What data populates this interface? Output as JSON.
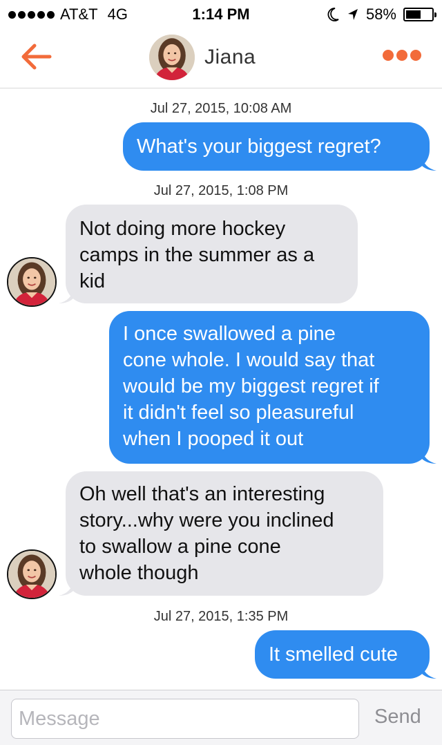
{
  "status_bar": {
    "carrier": "AT&T",
    "network": "4G",
    "time": "1:14 PM",
    "battery": "58%",
    "battery_level": 0.58,
    "icons": [
      "signal-dots-icon",
      "moon-icon",
      "location-arrow-icon",
      "battery-icon"
    ]
  },
  "header": {
    "contact_name": "Jiana",
    "back_icon": "back-arrow-icon",
    "more_icon": "more-dots-icon",
    "accent_color": "#f26b3a"
  },
  "chat": {
    "outgoing_color": "#2f8cf0",
    "incoming_color": "#e6e6ea",
    "timestamps": [
      "Jul 27, 2015, 10:08 AM",
      "Jul 27, 2015, 1:08 PM",
      "Jul 27, 2015, 1:35 PM"
    ],
    "messages": [
      {
        "from": "me",
        "lines": [
          "What's your biggest regret?"
        ]
      },
      {
        "from": "Jiana",
        "lines": [
          "Not doing more hockey",
          "camps in the summer as a",
          "kid"
        ]
      },
      {
        "from": "me",
        "lines": [
          "I once swallowed a pine",
          "cone whole. I would say that",
          "would be my biggest regret if",
          "it didn't feel so pleasureful",
          "when I pooped it out"
        ]
      },
      {
        "from": "Jiana",
        "lines": [
          "Oh well that's an interesting",
          "story...why were you inclined",
          "to swallow a pine cone",
          "whole though"
        ]
      },
      {
        "from": "me",
        "lines": [
          "It smelled cute"
        ]
      }
    ]
  },
  "composer": {
    "placeholder": "Message",
    "value": "",
    "send_label": "Send"
  }
}
